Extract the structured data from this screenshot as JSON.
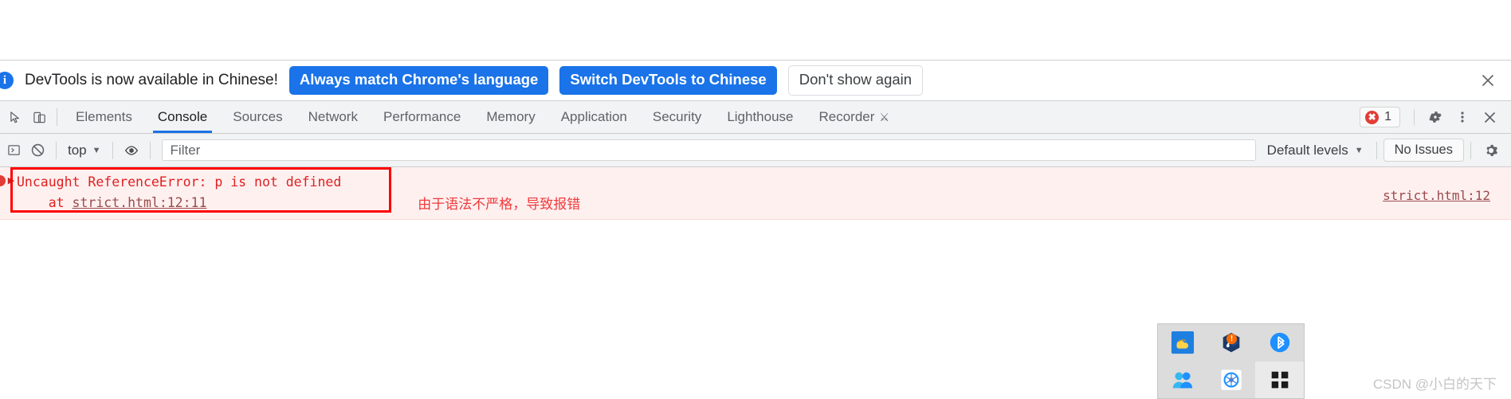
{
  "banner": {
    "info_icon": "info-icon",
    "message": "DevTools is now available in Chinese!",
    "primary_button": "Always match Chrome's language",
    "secondary_button": "Switch DevTools to Chinese",
    "dismiss_button": "Don't show again",
    "close_icon": "close-icon"
  },
  "tabbar": {
    "inspect_icon": "inspect-cursor-icon",
    "device_icon": "device-toolbar-icon",
    "tabs": [
      {
        "label": "Elements",
        "active": false
      },
      {
        "label": "Console",
        "active": true
      },
      {
        "label": "Sources",
        "active": false
      },
      {
        "label": "Network",
        "active": false
      },
      {
        "label": "Performance",
        "active": false
      },
      {
        "label": "Memory",
        "active": false
      },
      {
        "label": "Application",
        "active": false
      },
      {
        "label": "Security",
        "active": false
      },
      {
        "label": "Lighthouse",
        "active": false
      },
      {
        "label": "Recorder",
        "active": false
      }
    ],
    "recorder_glyph": "experiment-flask-icon",
    "error_count": "1",
    "settings_icon": "gear-icon",
    "more_icon": "more-vertical-icon",
    "close_icon": "close-icon"
  },
  "filterbar": {
    "sidebar_icon": "show-console-sidebar-icon",
    "clear_icon": "clear-console-icon",
    "context": "top",
    "context_caret": "▼",
    "eye_icon": "live-expression-eye-icon",
    "filter_placeholder": "Filter",
    "filter_value": "",
    "levels": "Default levels",
    "levels_caret": "▼",
    "issues": "No Issues",
    "settings_icon": "gear-icon"
  },
  "console": {
    "message": {
      "line1": "Uncaught ReferenceError: p is not defined",
      "line2_prefix": "    at ",
      "line2_link": "strict.html:12:11",
      "source_link": "strict.html:12",
      "expand_arrow": "▶"
    },
    "annotation": "由于语法不严格，导致报错"
  },
  "tray": {
    "items": [
      {
        "name": "onedrive-icon",
        "badge": ""
      },
      {
        "name": "network-warning-icon",
        "badge": "!"
      },
      {
        "name": "bluetooth-icon",
        "badge": ""
      },
      {
        "name": "contacts-icon",
        "badge": ""
      },
      {
        "name": "app-icon",
        "badge": ""
      },
      {
        "name": "show-hidden-icons-grid-icon",
        "badge": ""
      }
    ]
  },
  "watermark": "CSDN @小白的天下",
  "colors": {
    "accent": "#1a73e8",
    "error": "#e23c36",
    "error_bg": "#fff0f0",
    "toolbar_bg": "#f1f3f4",
    "annotation_red": "#ff0000"
  }
}
